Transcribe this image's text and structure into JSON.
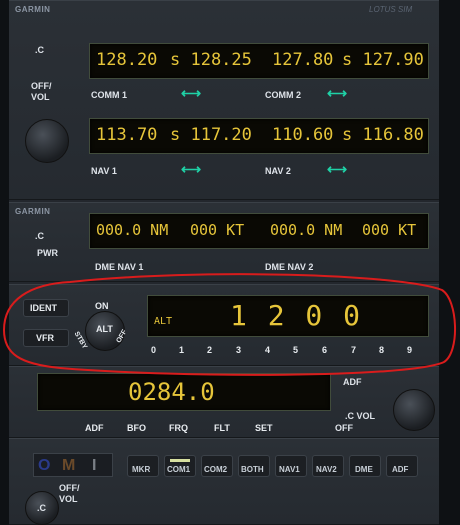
{
  "comm": {
    "brand": "GARMIN",
    "brand_right": "LOTUS SIM",
    "c_label": ".C",
    "offvol_line1": "OFF/",
    "offvol_line2": "VOL",
    "comm1": {
      "active": "128.20",
      "standby": "s 128.25",
      "label": "COMM 1"
    },
    "comm2": {
      "active": "127.80",
      "standby": "s 127.90",
      "label": "COMM 2"
    },
    "nav1": {
      "active": "113.70",
      "standby": "s 117.20",
      "label": "NAV 1"
    },
    "nav2": {
      "active": "110.60",
      "standby": "s 116.80",
      "label": "NAV 2"
    }
  },
  "dme": {
    "brand": "GARMIN",
    "c_label": ".C",
    "pwr": "PWR",
    "nav1_readout": "000.0 NM",
    "nav1_speed": "000 KT",
    "nav2_readout": "000.0 NM",
    "nav2_speed": "000 KT",
    "nav1_label": "DME NAV 1",
    "nav2_label": "DME NAV 2"
  },
  "xpdr": {
    "ident": "IDENT",
    "vfr": "VFR",
    "on": "ON",
    "alt": "ALT",
    "stby": "STBY",
    "off": "OFF",
    "mode": "ALT",
    "code": "1 2 0 0",
    "digits": [
      "0",
      "1",
      "2",
      "3",
      "4",
      "5",
      "6",
      "7",
      "8",
      "9"
    ]
  },
  "adf": {
    "frequency": "0284.0",
    "adf_top": "ADF",
    "c_vol": ".C VOL",
    "off": "OFF",
    "buttons": [
      "ADF",
      "BFO",
      "FRQ",
      "FLT",
      "SET"
    ]
  },
  "audio": {
    "omi": [
      "O",
      "M",
      "I"
    ],
    "buttons": [
      "MKR",
      "COM1",
      "COM2",
      "BOTH",
      "NAV1",
      "NAV2",
      "DME",
      "ADF"
    ],
    "active_index": 1,
    "c_label": ".C",
    "offvol_line1": "OFF/",
    "offvol_line2": "VOL"
  },
  "colors": {
    "display_text": "#e6c53a",
    "arrow": "#1fd1a6",
    "highlight_ring": "#d91c1c"
  }
}
